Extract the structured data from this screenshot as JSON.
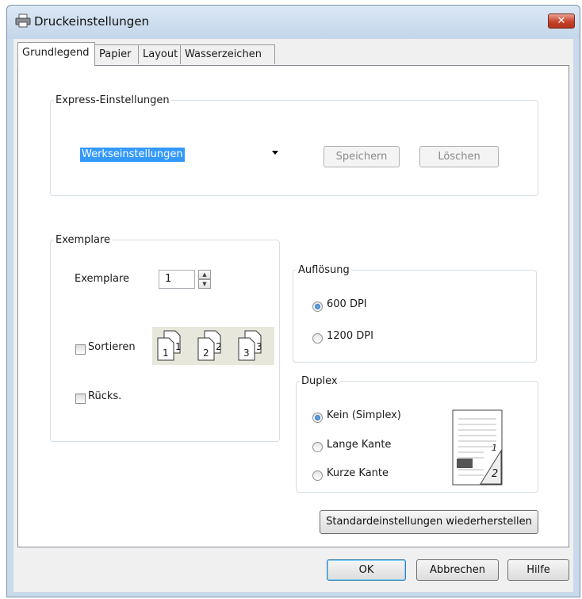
{
  "window": {
    "title": "Druckeinstellungen",
    "close_glyph": "✕"
  },
  "tabs": [
    "Grundlegend",
    "Papier",
    "Layout",
    "Wasserzeichen"
  ],
  "express": {
    "legend": "Express-Einstellungen",
    "selected": "Werkseinstellungen",
    "save_label": "Speichern",
    "delete_label": "Löschen"
  },
  "copies": {
    "legend": "Exemplare",
    "label": "Exemplare",
    "value": "1",
    "collate_label": "Sortieren",
    "reverse_label": "Rücks.",
    "collate_numbers": [
      "1",
      "1",
      "2",
      "2",
      "3",
      "3"
    ]
  },
  "resolution": {
    "legend": "Auflösung",
    "options": [
      "600 DPI",
      "1200 DPI"
    ],
    "selected_index": 0
  },
  "duplex": {
    "legend": "Duplex",
    "options": [
      "Kein (Simplex)",
      "Lange Kante",
      "Kurze Kante"
    ],
    "selected_index": 0,
    "preview_numbers": [
      "1",
      "2"
    ]
  },
  "restore_defaults_label": "Standardeinstellungen wiederherstellen",
  "footer": {
    "ok_label": "OK",
    "cancel_label": "Abbrechen",
    "help_label": "Hilfe"
  },
  "colors": {
    "accent": "#3399ff",
    "frame": "#c9daea",
    "close": "#c7412b"
  }
}
